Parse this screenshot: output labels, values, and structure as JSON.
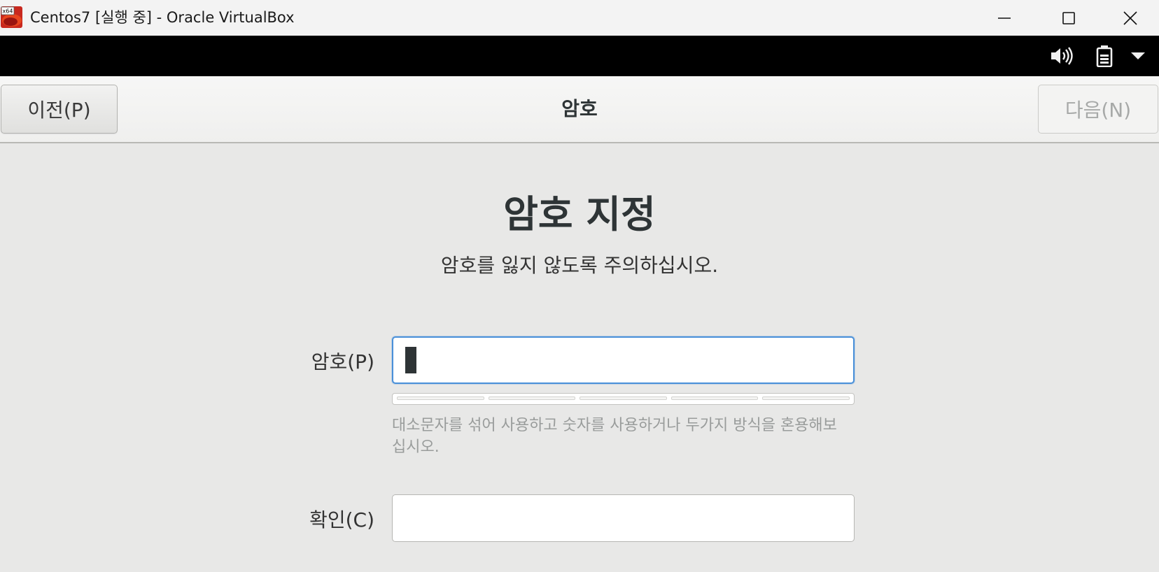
{
  "window": {
    "title": "Centos7 [실행 중] - Oracle VirtualBox",
    "app_icon_badge": "x64"
  },
  "header": {
    "prev_label": "이전(P)",
    "title": "암호",
    "next_label": "다음(N)"
  },
  "content": {
    "heading": "암호 지정",
    "subtitle": "암호를 잃지 않도록 주의하십시오.",
    "password_label": "암호(P)",
    "password_value": "",
    "hint": "대소문자를 섞어 사용하고 숫자를 사용하거나 두가지 방식을 혼용해보십시오.",
    "confirm_label": "확인(C)",
    "confirm_value": ""
  },
  "strength_meter": {
    "level": 0,
    "segments": 5
  },
  "colors": {
    "focus": "#4a90d9",
    "hint": "#999c9b",
    "topbar": "#000000"
  }
}
